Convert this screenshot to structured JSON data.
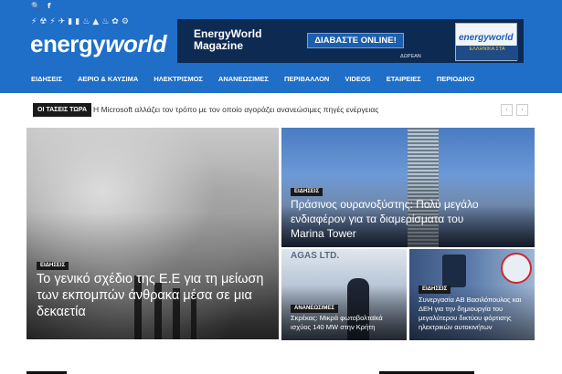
{
  "topbar": {
    "search_icon": "🔍",
    "facebook_icon": "f"
  },
  "logo": {
    "part1": "energy",
    "part2": "world"
  },
  "logo_icons": [
    "⚡",
    "☢",
    "⚡",
    "✈",
    "▮",
    "▮",
    "♨",
    "▲",
    "♨",
    "✿",
    "⚙"
  ],
  "banner": {
    "title": "EnergyWorld Magazine",
    "button": "ΔΙΑΒΑΣΤΕ ONLINE!",
    "free": "ΔΩΡΕΑΝ",
    "mag_logo": "energyworld",
    "mag_strip": "ΕΛΛΗΝΙΚΑ ΣΤΑ"
  },
  "nav": [
    "ΕΙΔΗΣΕΙΣ",
    "ΑΕΡΙΟ & ΚΑΥΣΙΜΑ",
    "ΗΛΕΚΤΡΙΣΜΟΣ",
    "ΑΝΑΝΕΩΣΙΜΕΣ",
    "ΠΕΡΙΒΑΛΛΟΝ",
    "VIDEOS",
    "ΕΤΑΙΡΕΙΕΣ",
    "ΠΕΡΙΟΔΙΚΟ"
  ],
  "ticker": {
    "label": "ΟΙ ΤΑΣΕΙΣ ΤΩΡΑ",
    "text": "Η Microsoft αλλάζει τον τρόπο με τον οποίο αγοράζει ανανεώσιμες πηγές ενέργειας",
    "prev": "‹",
    "next": "›"
  },
  "tiles": {
    "big": {
      "badge": "ΕΙΔΗΣΕΙΣ",
      "title": "Το γενικό σχέδιο της Ε.Ε για τη μείωση των εκπομπών άνθρακα μέσα σε μια δεκαετία"
    },
    "tower": {
      "badge": "ΕΙΔΗΣΕΙΣ",
      "title": "Πράσινος ουρανοξύστης: Πολύ μεγάλο ενδιαφέρον για τα διαμερίσματα του Marina Tower"
    },
    "small1": {
      "badge": "ΑΝΑΝΕΩΣΙΜΕΣ",
      "title": "Σκρέκας: Μικρά φωτοβολταϊκά ισχύος 140 MW στην Κρήτη",
      "bg_text": "AGAS LTD."
    },
    "small2": {
      "badge": "ΕΙΔΗΣΕΙΣ",
      "title": "Συνεργασία ΑΒ Βασιλόπουλος και ΔΕΗ για την δημιουργία του μεγαλύτερου δικτύου φόρτισης ηλεκτρικών αυτοκινήτων"
    }
  }
}
